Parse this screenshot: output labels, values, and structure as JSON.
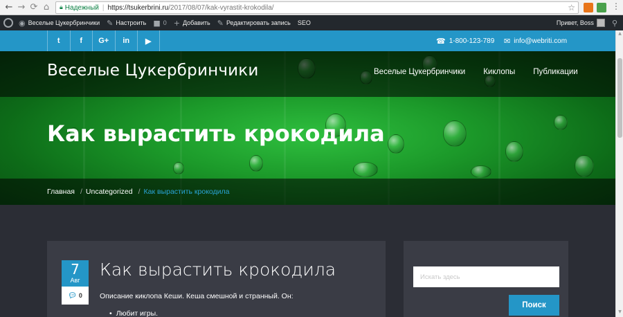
{
  "browser": {
    "secure_label": "Надежный",
    "url_host": "https://tsukerbrini.ru",
    "url_path": "/2017/08/07/kak-vyrastit-krokodila/"
  },
  "adminbar": {
    "site_name": "Веселые Цукербринчики",
    "customize": "Настроить",
    "comments_count": "0",
    "add_new": "Добавить",
    "edit_post": "Редактировать запись",
    "seo": "SEO",
    "greeting": "Привет, Boss"
  },
  "topbar": {
    "socials": [
      {
        "icon": "twitter-icon",
        "glyph": "t"
      },
      {
        "icon": "facebook-icon",
        "glyph": "f"
      },
      {
        "icon": "google-plus-icon",
        "glyph": "G+"
      },
      {
        "icon": "linkedin-icon",
        "glyph": "in"
      },
      {
        "icon": "youtube-icon",
        "glyph": "▶"
      }
    ],
    "phone": "1-800-123-789",
    "email": "info@webriti.com"
  },
  "header": {
    "site_title": "Веселые Цукербринчики",
    "nav": [
      "Веселые Цукербринчики",
      "Киклопы",
      "Публикации"
    ]
  },
  "hero": {
    "title": "Как вырастить крокодила",
    "breadcrumbs": [
      "Главная",
      "Uncategorized",
      "Как вырастить крокодила"
    ]
  },
  "post": {
    "day": "7",
    "month": "Авг",
    "comments": "0",
    "title": "Как вырастить крокодила",
    "excerpt": "Описание киклопа Кеши. Кеша смешной и странный. Он:",
    "list_item": "Любит игры."
  },
  "sidebar": {
    "search_placeholder": "Искать здесь",
    "search_button": "Поиск"
  },
  "colors": {
    "accent": "#2496c7",
    "adminbar": "#23282d",
    "content_bg": "#2b2d35",
    "card_bg": "#3a3c45"
  }
}
